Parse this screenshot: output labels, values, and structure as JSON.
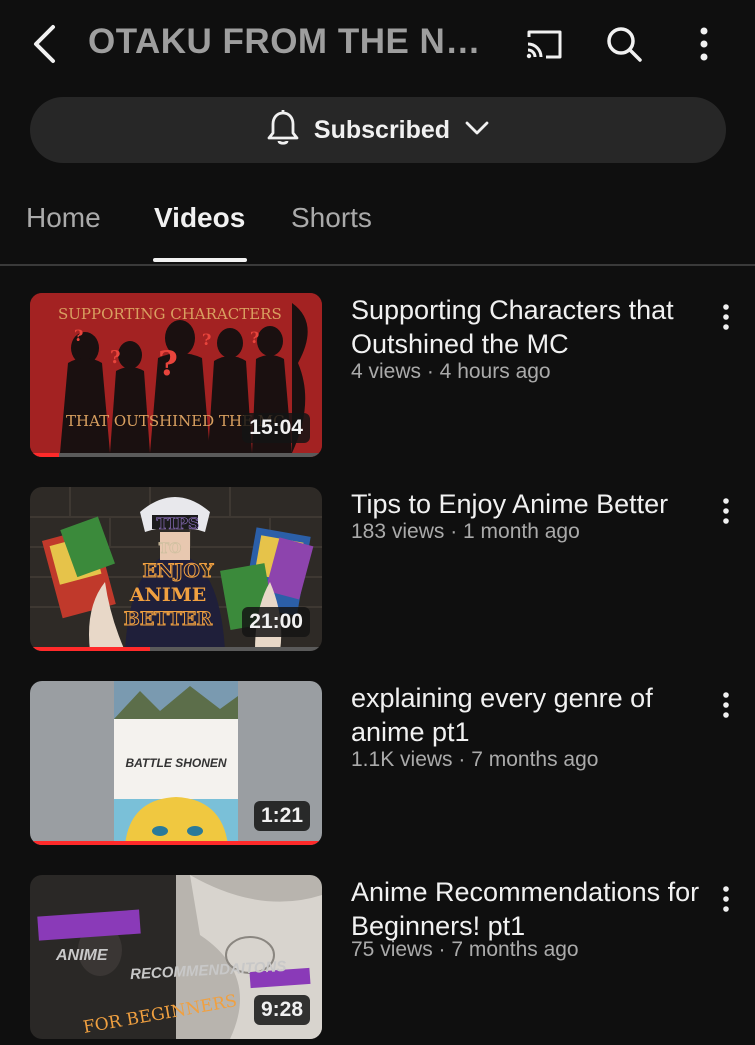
{
  "header": {
    "title": "OTAKU FROM THE N…",
    "icons": [
      "back-arrow-icon",
      "cast-icon",
      "search-icon",
      "more-vertical-icon"
    ]
  },
  "subscribe": {
    "label": "Subscribed",
    "icons": [
      "bell-icon",
      "chevron-down-icon"
    ]
  },
  "tabs": [
    {
      "label": "Home",
      "active": false
    },
    {
      "label": "Videos",
      "active": true
    },
    {
      "label": "Shorts",
      "active": false
    }
  ],
  "videos": [
    {
      "title": "Supporting Characters that Outshined the MC",
      "meta": "4 views · 4 hours ago",
      "duration": "15:04",
      "watched": 0.1,
      "thumb_text": [
        "SUPPORTING CHARACTERS",
        "THAT OUTSHINED THE MC"
      ]
    },
    {
      "title": "Tips to Enjoy Anime Better",
      "meta": "183 views · 1 month ago",
      "duration": "21:00",
      "watched": 0.41,
      "thumb_text": [
        "TIPS",
        "TO",
        "ENJOY",
        "ANIME",
        "BETTER"
      ]
    },
    {
      "title": "explaining every genre of anime pt1",
      "meta": "1.1K views · 7 months ago",
      "duration": "1:21",
      "watched": 1.0,
      "thumb_text": [
        "BATTLE SHONEN"
      ]
    },
    {
      "title": "Anime Recommendations for Beginners! pt1",
      "meta": "75 views · 7 months ago",
      "duration": "9:28",
      "watched": 0,
      "thumb_text": [
        "ANIME",
        "RECOMMENDAITONS",
        "FOR BEGINNERS"
      ]
    }
  ],
  "colors": {
    "background": "#0f0f0f",
    "progress": "#ff2a2a",
    "chip": "#272727"
  }
}
